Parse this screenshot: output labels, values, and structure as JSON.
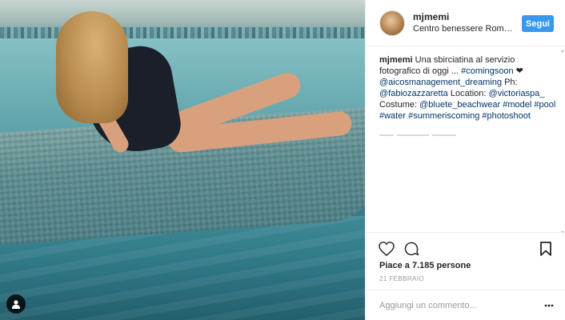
{
  "post": {
    "username": "mjmemi",
    "location": "Centro benessere Roma ...",
    "follow_label": "Segui",
    "caption": {
      "username": "mjmemi",
      "text": "Una sbirciatina al servizio fotografico di oggi ...",
      "tag1": "#comingsoon",
      "heart": "❤",
      "mention1": "@aicosmanagement_dreaming",
      "ph_label": "Ph:",
      "mention2": "@fabiozazzaretta",
      "location_label": "Location:",
      "mention3": "@victoriaspa_",
      "costume_label": "Costume:",
      "mention4": "@bluete_beachwear",
      "tag2": "#model",
      "tag3": "#pool",
      "tag4": "#water",
      "tag5": "#summeriscoming",
      "tag6": "#photoshoot"
    },
    "likes_text": "Piace a 7.185 persone",
    "date": "21 FEBBRAIO",
    "comment_placeholder": "Aggiungi un commento..."
  },
  "icons": {
    "like": "heart-icon",
    "comment": "comment-icon",
    "save": "bookmark-icon",
    "options": "more-options-icon",
    "user_tag": "user-tag-icon"
  },
  "colors": {
    "accent": "#3897f0",
    "link": "#003569",
    "muted": "#999999",
    "text": "#262626"
  }
}
